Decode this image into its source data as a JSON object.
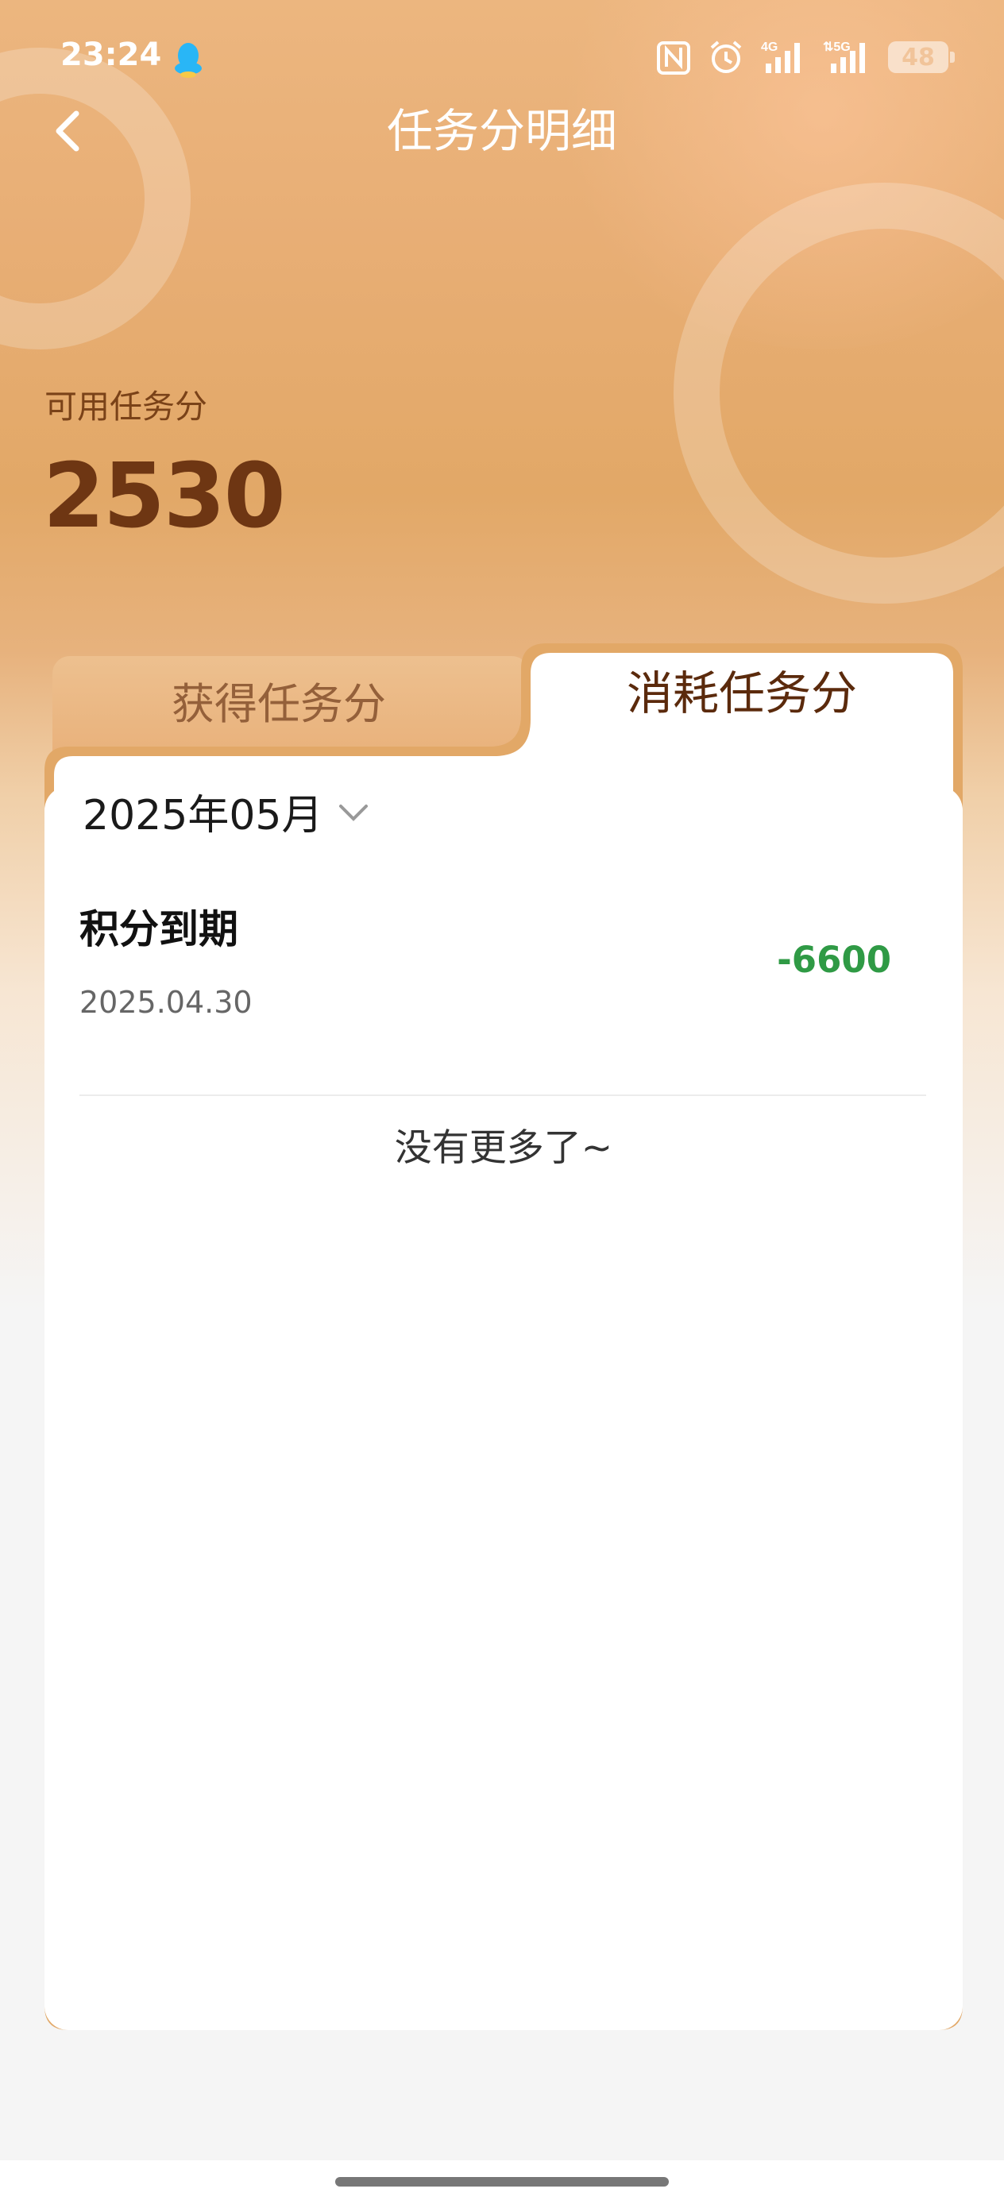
{
  "status_bar": {
    "time": "23:24",
    "battery": "48",
    "icons": [
      "qq-icon",
      "nfc-icon",
      "alarm-icon",
      "signal-4g-icon",
      "signal-5g-icon",
      "battery-icon"
    ]
  },
  "header": {
    "title": "任务分明细",
    "back_icon": "chevron-left-icon"
  },
  "balance": {
    "label": "可用任务分",
    "value": "2530"
  },
  "tabs": [
    {
      "label": "获得任务分",
      "active": false
    },
    {
      "label": "消耗任务分",
      "active": true
    }
  ],
  "filter": {
    "month": "2025年05月",
    "icon": "chevron-down-icon"
  },
  "records": [
    {
      "title": "积分到期",
      "date": "2025.04.30",
      "amount": "-6600"
    }
  ],
  "footer_text": "没有更多了~",
  "colors": {
    "accent_brown": "#6e3613",
    "amount_green": "#2f9a45",
    "card_border": "#e2a867"
  }
}
